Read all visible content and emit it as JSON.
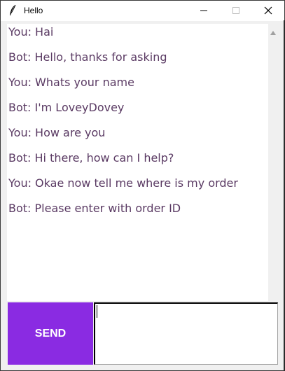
{
  "window": {
    "title": "Hello",
    "icon": "feather-icon",
    "controls": [
      "minimize-icon",
      "maximize-icon",
      "close-icon"
    ]
  },
  "chat": {
    "messages": [
      "You: Hai",
      "Bot: Hello, thanks for asking",
      "You: Whats your name",
      "Bot: I'm LoveyDovey",
      "You: How are you",
      "Bot: Hi there, how can I help?",
      "You: Okae now tell me where is my order",
      "Bot: Please enter with order ID"
    ]
  },
  "composer": {
    "send_label": "SEND",
    "input_value": ""
  },
  "colors": {
    "send_button": "#8a2be2",
    "message_text": "#5a3a63"
  }
}
